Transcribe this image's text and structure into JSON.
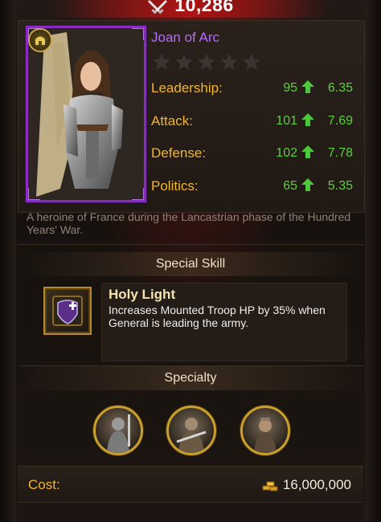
{
  "power": {
    "value": "10,286",
    "icon": "crossed-swords-icon"
  },
  "general": {
    "name": "Joan of Arc",
    "stars_filled": 0,
    "stars_total": 5,
    "stats": [
      {
        "label": "Leadership:",
        "value": "95",
        "growth": "6.35"
      },
      {
        "label": "Attack:",
        "value": "101",
        "growth": "7.69"
      },
      {
        "label": "Defense:",
        "value": "102",
        "growth": "7.78"
      },
      {
        "label": "Politics:",
        "value": "65",
        "growth": "5.35"
      }
    ],
    "description": "A heroine of France during the Lancastrian phase of the Hundred Years' War."
  },
  "special_skill": {
    "section_title": "Special Skill",
    "name": "Holy Light",
    "description": "Increases Mounted Troop HP by 35% when General is leading the army.",
    "icon": "shield-cross-icon"
  },
  "specialty": {
    "section_title": "Specialty",
    "items": [
      "knight-portrait-icon",
      "soldier-portrait-icon",
      "guard-portrait-icon"
    ]
  },
  "cost": {
    "label": "Cost:",
    "value": "16,000,000",
    "icon": "gold-icon"
  },
  "colors": {
    "name": "#b36cff",
    "stat_label": "#f2b52e",
    "stat_value": "#59d13b",
    "frame": "#8a2bc4"
  }
}
